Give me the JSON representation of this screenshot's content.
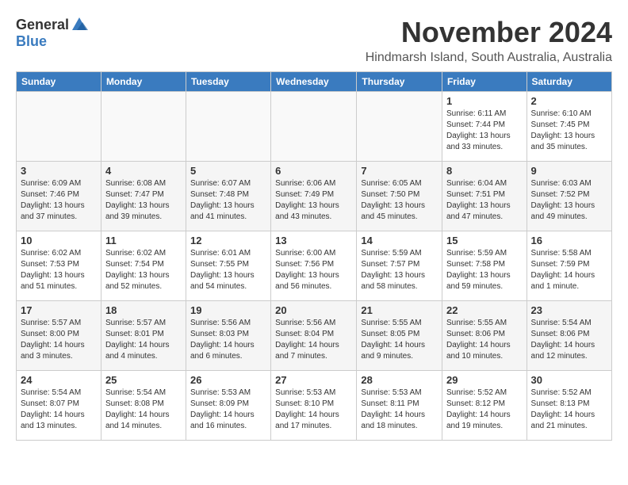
{
  "logo": {
    "general": "General",
    "blue": "Blue"
  },
  "title": "November 2024",
  "subtitle": "Hindmarsh Island, South Australia, Australia",
  "days_of_week": [
    "Sunday",
    "Monday",
    "Tuesday",
    "Wednesday",
    "Thursday",
    "Friday",
    "Saturday"
  ],
  "weeks": [
    [
      {
        "day": "",
        "content": ""
      },
      {
        "day": "",
        "content": ""
      },
      {
        "day": "",
        "content": ""
      },
      {
        "day": "",
        "content": ""
      },
      {
        "day": "",
        "content": ""
      },
      {
        "day": "1",
        "content": "Sunrise: 6:11 AM\nSunset: 7:44 PM\nDaylight: 13 hours\nand 33 minutes."
      },
      {
        "day": "2",
        "content": "Sunrise: 6:10 AM\nSunset: 7:45 PM\nDaylight: 13 hours\nand 35 minutes."
      }
    ],
    [
      {
        "day": "3",
        "content": "Sunrise: 6:09 AM\nSunset: 7:46 PM\nDaylight: 13 hours\nand 37 minutes."
      },
      {
        "day": "4",
        "content": "Sunrise: 6:08 AM\nSunset: 7:47 PM\nDaylight: 13 hours\nand 39 minutes."
      },
      {
        "day": "5",
        "content": "Sunrise: 6:07 AM\nSunset: 7:48 PM\nDaylight: 13 hours\nand 41 minutes."
      },
      {
        "day": "6",
        "content": "Sunrise: 6:06 AM\nSunset: 7:49 PM\nDaylight: 13 hours\nand 43 minutes."
      },
      {
        "day": "7",
        "content": "Sunrise: 6:05 AM\nSunset: 7:50 PM\nDaylight: 13 hours\nand 45 minutes."
      },
      {
        "day": "8",
        "content": "Sunrise: 6:04 AM\nSunset: 7:51 PM\nDaylight: 13 hours\nand 47 minutes."
      },
      {
        "day": "9",
        "content": "Sunrise: 6:03 AM\nSunset: 7:52 PM\nDaylight: 13 hours\nand 49 minutes."
      }
    ],
    [
      {
        "day": "10",
        "content": "Sunrise: 6:02 AM\nSunset: 7:53 PM\nDaylight: 13 hours\nand 51 minutes."
      },
      {
        "day": "11",
        "content": "Sunrise: 6:02 AM\nSunset: 7:54 PM\nDaylight: 13 hours\nand 52 minutes."
      },
      {
        "day": "12",
        "content": "Sunrise: 6:01 AM\nSunset: 7:55 PM\nDaylight: 13 hours\nand 54 minutes."
      },
      {
        "day": "13",
        "content": "Sunrise: 6:00 AM\nSunset: 7:56 PM\nDaylight: 13 hours\nand 56 minutes."
      },
      {
        "day": "14",
        "content": "Sunrise: 5:59 AM\nSunset: 7:57 PM\nDaylight: 13 hours\nand 58 minutes."
      },
      {
        "day": "15",
        "content": "Sunrise: 5:59 AM\nSunset: 7:58 PM\nDaylight: 13 hours\nand 59 minutes."
      },
      {
        "day": "16",
        "content": "Sunrise: 5:58 AM\nSunset: 7:59 PM\nDaylight: 14 hours\nand 1 minute."
      }
    ],
    [
      {
        "day": "17",
        "content": "Sunrise: 5:57 AM\nSunset: 8:00 PM\nDaylight: 14 hours\nand 3 minutes."
      },
      {
        "day": "18",
        "content": "Sunrise: 5:57 AM\nSunset: 8:01 PM\nDaylight: 14 hours\nand 4 minutes."
      },
      {
        "day": "19",
        "content": "Sunrise: 5:56 AM\nSunset: 8:03 PM\nDaylight: 14 hours\nand 6 minutes."
      },
      {
        "day": "20",
        "content": "Sunrise: 5:56 AM\nSunset: 8:04 PM\nDaylight: 14 hours\nand 7 minutes."
      },
      {
        "day": "21",
        "content": "Sunrise: 5:55 AM\nSunset: 8:05 PM\nDaylight: 14 hours\nand 9 minutes."
      },
      {
        "day": "22",
        "content": "Sunrise: 5:55 AM\nSunset: 8:06 PM\nDaylight: 14 hours\nand 10 minutes."
      },
      {
        "day": "23",
        "content": "Sunrise: 5:54 AM\nSunset: 8:06 PM\nDaylight: 14 hours\nand 12 minutes."
      }
    ],
    [
      {
        "day": "24",
        "content": "Sunrise: 5:54 AM\nSunset: 8:07 PM\nDaylight: 14 hours\nand 13 minutes."
      },
      {
        "day": "25",
        "content": "Sunrise: 5:54 AM\nSunset: 8:08 PM\nDaylight: 14 hours\nand 14 minutes."
      },
      {
        "day": "26",
        "content": "Sunrise: 5:53 AM\nSunset: 8:09 PM\nDaylight: 14 hours\nand 16 minutes."
      },
      {
        "day": "27",
        "content": "Sunrise: 5:53 AM\nSunset: 8:10 PM\nDaylight: 14 hours\nand 17 minutes."
      },
      {
        "day": "28",
        "content": "Sunrise: 5:53 AM\nSunset: 8:11 PM\nDaylight: 14 hours\nand 18 minutes."
      },
      {
        "day": "29",
        "content": "Sunrise: 5:52 AM\nSunset: 8:12 PM\nDaylight: 14 hours\nand 19 minutes."
      },
      {
        "day": "30",
        "content": "Sunrise: 5:52 AM\nSunset: 8:13 PM\nDaylight: 14 hours\nand 21 minutes."
      }
    ]
  ]
}
